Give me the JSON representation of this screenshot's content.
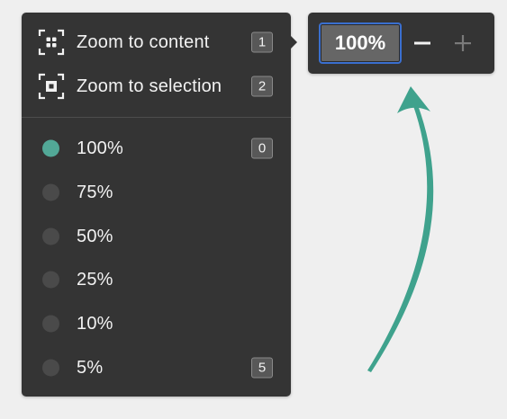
{
  "menu": {
    "actions": [
      {
        "label": "Zoom to content",
        "shortcut": "1",
        "icon": "zoom-to-content-icon"
      },
      {
        "label": "Zoom to selection",
        "shortcut": "2",
        "icon": "zoom-to-selection-icon"
      }
    ],
    "levels": [
      {
        "label": "100%",
        "shortcut": "0",
        "selected": true
      },
      {
        "label": "75%",
        "shortcut": "",
        "selected": false
      },
      {
        "label": "50%",
        "shortcut": "",
        "selected": false
      },
      {
        "label": "25%",
        "shortcut": "",
        "selected": false
      },
      {
        "label": "10%",
        "shortcut": "",
        "selected": false
      },
      {
        "label": "5%",
        "shortcut": "5",
        "selected": false
      }
    ]
  },
  "zoom_control": {
    "value": "100%",
    "decrease_icon": "minus-icon",
    "increase_icon": "plus-icon"
  },
  "colors": {
    "panel": "#343434",
    "accent": "#52a897",
    "focus_border": "#3a6fcf",
    "background": "#efefef"
  }
}
